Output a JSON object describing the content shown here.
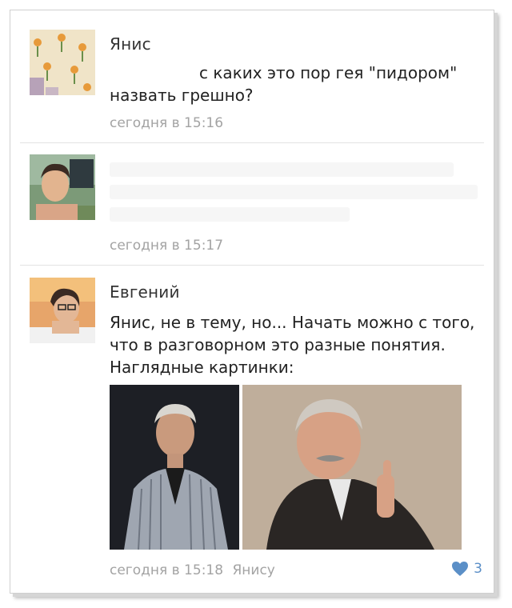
{
  "comments": [
    {
      "author": "Янис",
      "text_line1": "с каких это пор гея \"пидором\"",
      "text_line2": "назвать грешно?",
      "time": "сегодня в 15:16"
    },
    {
      "author": "",
      "time": "сегодня в 15:17"
    },
    {
      "author": "Евгений",
      "text_line1": "Янис, не в тему, но... Начать можно с того,",
      "text_line2": "что в разговорном это разные понятия.",
      "text_line3": "Наглядные картинки:",
      "time": "сегодня в 15:18",
      "reply_to": "Янису",
      "likes": "3"
    }
  ],
  "colors": {
    "meta_text": "#a3a3a3",
    "like_accent": "#5b8fc7",
    "separator": "#e3e3e3"
  },
  "icons": {
    "like": "heart-icon"
  }
}
